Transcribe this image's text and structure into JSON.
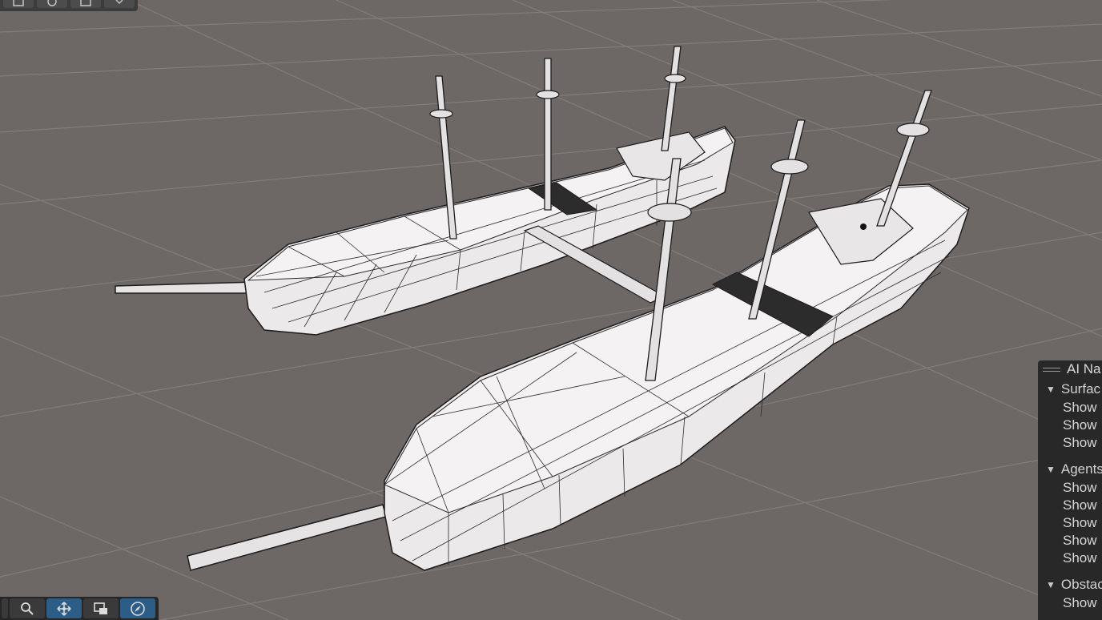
{
  "scene": {
    "background_color": "#6d6865",
    "grid_color": "#807a76",
    "model_fill": "#ece9ea",
    "wire_color": "#1c1c1c"
  },
  "top_toolbar": {
    "buttons": [
      {
        "icon": "layout-icon"
      },
      {
        "icon": "rotate-icon"
      },
      {
        "icon": "camera-icon"
      },
      {
        "icon": "dropdown-icon"
      }
    ]
  },
  "bottom_toolbar": {
    "buttons": [
      {
        "icon": "overlay-menu-icon"
      },
      {
        "icon": "search-icon"
      },
      {
        "icon": "move-icon",
        "active": true
      },
      {
        "icon": "view-icon"
      },
      {
        "icon": "compass-icon",
        "active": true
      }
    ]
  },
  "nav_panel": {
    "title": "AI Na",
    "sections": [
      {
        "label": "Surfac",
        "options": [
          "Show",
          "Show",
          "Show"
        ]
      },
      {
        "label": "Agents",
        "options": [
          "Show",
          "Show",
          "Show",
          "Show",
          "Show"
        ]
      },
      {
        "label": "Obstac",
        "options": [
          "Show"
        ]
      }
    ]
  }
}
